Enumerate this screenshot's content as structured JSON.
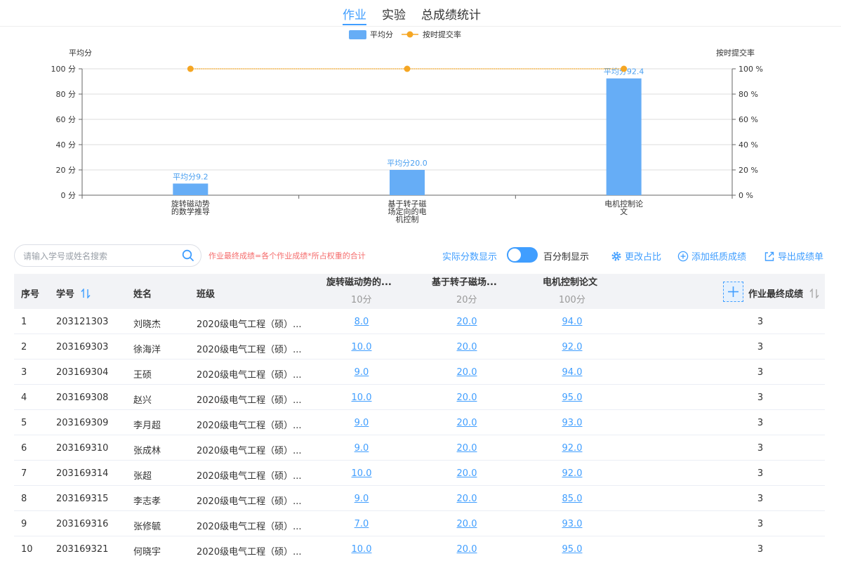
{
  "tabs": [
    {
      "label": "作业",
      "active": true
    },
    {
      "label": "实验",
      "active": false
    },
    {
      "label": "总成绩统计",
      "active": false
    }
  ],
  "chart_data": {
    "type": "bar",
    "categories": [
      "旋转磁动势的数学推导",
      "基于转子磁场定向的电机控制",
      "电机控制论文"
    ],
    "category_label_lines": [
      [
        "旋转磁动势",
        "的数学推导"
      ],
      [
        "基于转子磁",
        "场定向的电",
        "机控制"
      ],
      [
        "电机控制论",
        "文"
      ]
    ],
    "series": [
      {
        "name": "平均分",
        "type": "bar",
        "values": [
          9.2,
          20.0,
          92.4
        ],
        "color": "#66adf6",
        "label_prefix": "平均分"
      },
      {
        "name": "按时提交率",
        "type": "line",
        "values": [
          100,
          100,
          100
        ],
        "color": "#f5a623"
      }
    ],
    "ylabel": "平均分",
    "ylabel_right": "按时提交率",
    "ylim": [
      0,
      100
    ],
    "ylim_right": [
      0,
      100
    ],
    "yticks": [
      0,
      20,
      40,
      60,
      80,
      100
    ],
    "ytick_suffix": " 分",
    "ytick_suffix_right": " %",
    "legend_position": "top-center",
    "grid": true
  },
  "toolbar": {
    "search_placeholder": "请输入学号或姓名搜索",
    "formula_note": "作业最终成绩=各个作业成绩*所占权重的合计",
    "actual_label": "实际分数显示",
    "percent_label": "百分制显示",
    "change_weight": "更改占比",
    "add_paper": "添加纸质成绩",
    "export": "导出成绩单"
  },
  "table": {
    "headers": {
      "index": "序号",
      "student_id": "学号",
      "name": "姓名",
      "class": "班级",
      "hw1": "旋转磁动势的...",
      "hw1_sub": "10分",
      "hw2": "基于转子磁场...",
      "hw2_sub": "20分",
      "hw3": "电机控制论文",
      "hw3_sub": "100分",
      "final": "作业最终成绩"
    },
    "rows": [
      {
        "index": "1",
        "student_id": "203121303",
        "name": "刘晓杰",
        "class": "2020级电气工程（硕）...",
        "hw1": "8.0",
        "hw2": "20.0",
        "hw3": "94.0",
        "final": "3"
      },
      {
        "index": "2",
        "student_id": "203169303",
        "name": "徐海洋",
        "class": "2020级电气工程（硕）...",
        "hw1": "10.0",
        "hw2": "20.0",
        "hw3": "92.0",
        "final": "3"
      },
      {
        "index": "3",
        "student_id": "203169304",
        "name": "王硕",
        "class": "2020级电气工程（硕）...",
        "hw1": "9.0",
        "hw2": "20.0",
        "hw3": "94.0",
        "final": "3"
      },
      {
        "index": "4",
        "student_id": "203169308",
        "name": "赵兴",
        "class": "2020级电气工程（硕）...",
        "hw1": "10.0",
        "hw2": "20.0",
        "hw3": "95.0",
        "final": "3"
      },
      {
        "index": "5",
        "student_id": "203169309",
        "name": "李月超",
        "class": "2020级电气工程（硕）...",
        "hw1": "9.0",
        "hw2": "20.0",
        "hw3": "93.0",
        "final": "3"
      },
      {
        "index": "6",
        "student_id": "203169310",
        "name": "张成林",
        "class": "2020级电气工程（硕）...",
        "hw1": "9.0",
        "hw2": "20.0",
        "hw3": "92.0",
        "final": "3"
      },
      {
        "index": "7",
        "student_id": "203169314",
        "name": "张超",
        "class": "2020级电气工程（硕）...",
        "hw1": "10.0",
        "hw2": "20.0",
        "hw3": "92.0",
        "final": "3"
      },
      {
        "index": "8",
        "student_id": "203169315",
        "name": "李志孝",
        "class": "2020级电气工程（硕）...",
        "hw1": "9.0",
        "hw2": "20.0",
        "hw3": "85.0",
        "final": "3"
      },
      {
        "index": "9",
        "student_id": "203169316",
        "name": "张修毓",
        "class": "2020级电气工程（硕）...",
        "hw1": "7.0",
        "hw2": "20.0",
        "hw3": "93.0",
        "final": "3"
      },
      {
        "index": "10",
        "student_id": "203169321",
        "name": "何晓宇",
        "class": "2020级电气工程（硕）...",
        "hw1": "10.0",
        "hw2": "20.0",
        "hw3": "95.0",
        "final": "3"
      }
    ]
  }
}
